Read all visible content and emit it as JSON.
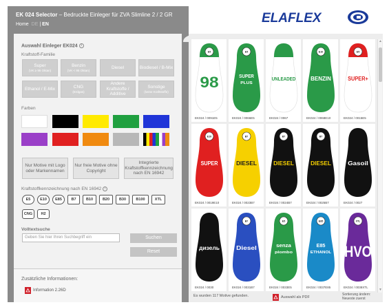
{
  "header": {
    "title_bold": "EK 024 Selector",
    "title_rest": " – Bedruckte Einleger für ZVA Slimline 2 / 2 GR",
    "nav_home": "Home",
    "lang_de": "DE",
    "lang_en": "EN",
    "logo_text": "ELAFLEX"
  },
  "filters": {
    "section_title": "Auswahl Einleger EK024",
    "fuel_family_label": "Kraftstoff-Familie",
    "fuel_buttons": [
      {
        "label": "Super",
        "sub": "(VK ≥ 95 Oktan)"
      },
      {
        "label": "Benzin",
        "sub": "(VK < 95 Oktan)"
      },
      {
        "label": "Diesel",
        "sub": ""
      },
      {
        "label": "Biodiesel / B-Mix",
        "sub": ""
      },
      {
        "label": "Ethanol / E-Mix",
        "sub": ""
      },
      {
        "label": "CNG",
        "sub": "(Erdgas)"
      },
      {
        "label": "Andere Kraftstoffe / Additive",
        "sub": ""
      },
      {
        "label": "Sonstige",
        "sub": "(keine Kraftstoffe)"
      }
    ],
    "colors_label": "Farben",
    "colors": [
      "#ffffff",
      "#000000",
      "#ffea00",
      "#20a040",
      "#2035d8",
      "#9a3fc8",
      "#e02020",
      "#f08a10",
      "#b8b8b8",
      "multi"
    ],
    "motif_buttons": [
      "Nur Motive mit Logo oder Markennamen",
      "Nur freie Motive ohne Copyright",
      "Integrierte Kraftstoffkennzeichnung nach EN 16942"
    ],
    "en_label": "Kraftstoffkennzeichnung nach EN 16942",
    "standards_row1": [
      "E5",
      "E10",
      "E85",
      "B7",
      "B10",
      "B20",
      "B30",
      "B100",
      "XTL"
    ],
    "standards_row2": [
      "CNG",
      "H2"
    ],
    "fulltext_label": "Volltextsuche",
    "search_placeholder": "Geben Sie hier Ihren Suchbegriff ein",
    "search_button": "Suchen",
    "reset_button": "Reset",
    "extra_info_title": "Zusätzliche Informationen:",
    "info_link": "Information 2.26D"
  },
  "products": [
    {
      "code": "EK024 / 0091E5",
      "color": "#2a9a48",
      "text": "98",
      "badge": "E5",
      "text_color": "#2a9a48",
      "body": "white"
    },
    {
      "code": "EK024 / 0066E5",
      "color": "#2a9a48",
      "text": "SUPER PLUS",
      "badge": "E5",
      "text_color": "#ffffff",
      "body": "green"
    },
    {
      "code": "EK024 / 0067",
      "color": "#2a9a48",
      "text": "UNLEADED",
      "badge": "",
      "text_color": "#2a9a48",
      "body": "white"
    },
    {
      "code": "EK024 / 0068E10",
      "color": "#2a9a48",
      "text": "BENZIN",
      "badge": "E10",
      "text_color": "#ffffff",
      "body": "green"
    },
    {
      "code": "EK024 / 0015E5",
      "color": "#e02020",
      "text": "SUPER+",
      "badge": "E5",
      "text_color": "#e02020",
      "body": "white"
    },
    {
      "code": "EK024 / 0019E10",
      "color": "#e02020",
      "text": "SUPER",
      "badge": "E10",
      "text_color": "#ffffff",
      "body": "red"
    },
    {
      "code": "EK024 / 0023B7",
      "color": "#f6d000",
      "text": "DIESEL",
      "badge": "B7",
      "text_color": "#1a1a1a",
      "body": "yellow"
    },
    {
      "code": "EK024 / 0024B7",
      "color": "#111111",
      "text": "DIESEL",
      "badge": "B7",
      "text_color": "#f6d000",
      "body": "black"
    },
    {
      "code": "EK024 / 0025B7",
      "color": "#111111",
      "text": "DIESEL",
      "badge": "B7",
      "text_color": "#f6d000",
      "body": "black"
    },
    {
      "code": "EK024 / 0027",
      "color": "#111111",
      "text": "Gasoil",
      "badge": "",
      "text_color": "#ffffff",
      "body": "black"
    },
    {
      "code": "EK024 / 0030",
      "color": "#111111",
      "text": "дизель",
      "badge": "",
      "text_color": "#ffffff",
      "body": "black"
    },
    {
      "code": "EK024 / 0031B7",
      "color": "#2a4fc0",
      "text": "Diesel",
      "badge": "B7",
      "text_color": "#ffffff",
      "body": "blue"
    },
    {
      "code": "EK024 / 0033E5",
      "color": "#2a9a48",
      "text": "senza piombo",
      "badge": "E5",
      "text_color": "#ffffff",
      "body": "green"
    },
    {
      "code": "EK024 / 0037E85",
      "color": "#1a8ac8",
      "text": "E85 ETHANOL",
      "badge": "E85",
      "text_color": "#ffffff",
      "body": "cyan"
    },
    {
      "code": "EK024 / 0038XTL",
      "color": "#6a2a9a",
      "text": "HVO",
      "badge": "XTL",
      "text_color": "#ffffff",
      "body": "purple"
    }
  ],
  "footer": {
    "found_text": "Es wurden 117 Motive gefunden.",
    "pdf_text": "Auswahl als PDF",
    "sort_line1": "Sortierung ändern:",
    "sort_line2": "Neueste zuerst"
  }
}
